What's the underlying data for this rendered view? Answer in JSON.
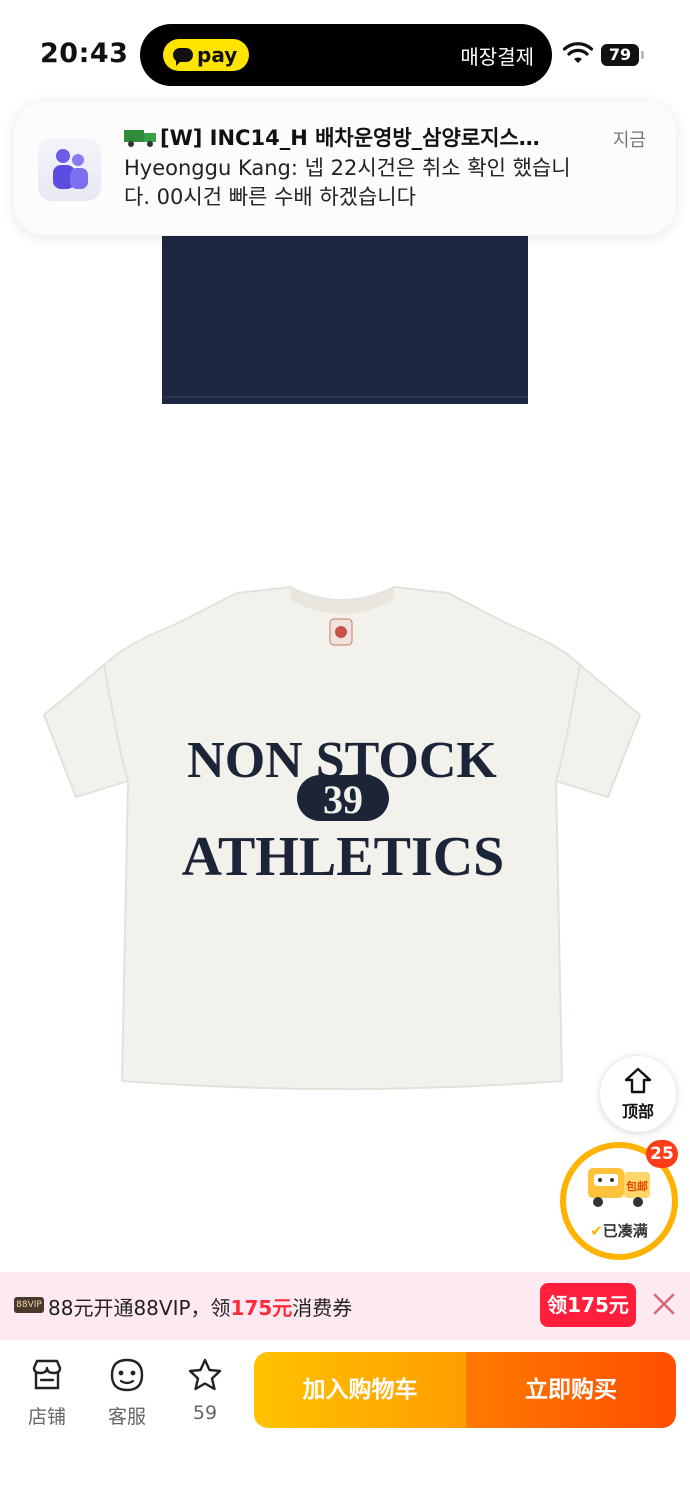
{
  "status_bar": {
    "time": "20:43",
    "pay_label": "pay",
    "island_text": "매장결제",
    "battery": "79"
  },
  "notification": {
    "title": "[W] INC14_H 배차운영방_삼양로지스…",
    "body": "Hyeonggu Kang: 넵 22시건은 취소 확인 했습니다. 00시건 빠른 수배 하겠습니다",
    "time": "지금"
  },
  "product_image": {
    "print_line1": "NON STOCK",
    "print_number": "39",
    "print_line2": "ATHLETICS"
  },
  "floating": {
    "top_label": "顶部",
    "shipping_count": "25",
    "shipping_label": "已凑满",
    "shipping_tag": "包邮"
  },
  "promo": {
    "vip_badge": "88VIP",
    "text_prefix": "88元开通88VIP，领",
    "text_amount": "175元",
    "text_suffix": "消费券",
    "claim_label": "领175元"
  },
  "bottom_bar": {
    "store_label": "店铺",
    "service_label": "客服",
    "favorite_count": "59",
    "cart_label": "加入购物车",
    "buy_label": "立即购买"
  },
  "colors": {
    "accent_yellow": "#ffc300",
    "accent_orange": "#ff4e00",
    "promo_red": "#ff1f3d",
    "navy_shirt": "#1e2742"
  }
}
